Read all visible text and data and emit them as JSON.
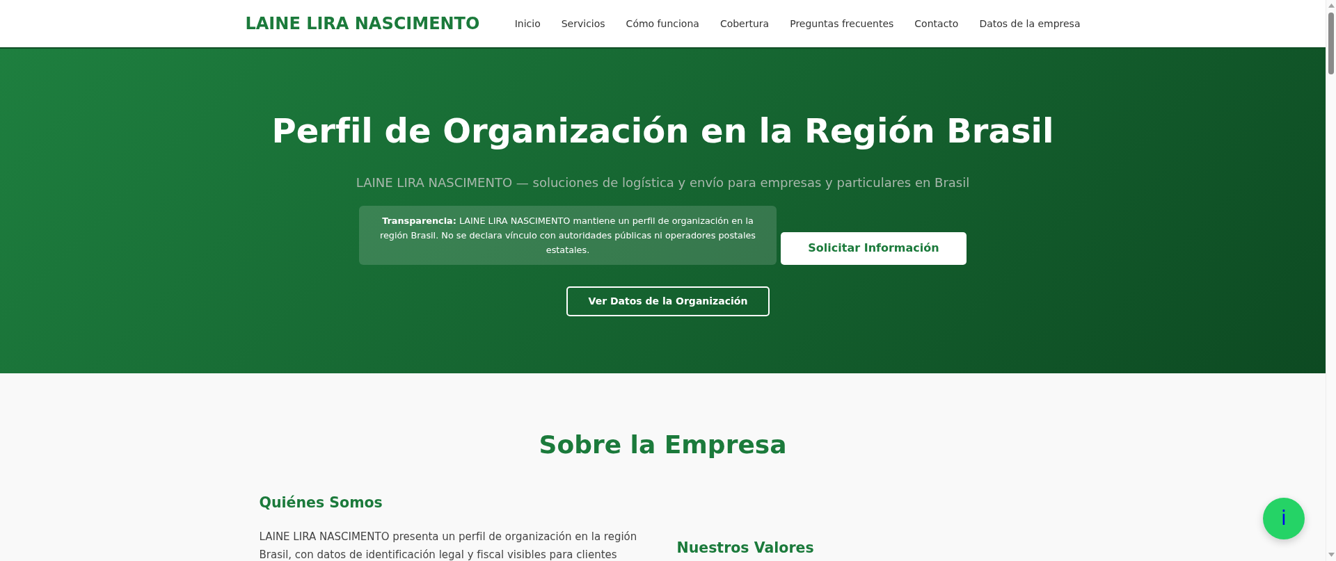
{
  "navbar": {
    "brand": "LAINE LIRA NASCIMENTO",
    "links": [
      {
        "label": "Inicio"
      },
      {
        "label": "Servicios"
      },
      {
        "label": "Cómo funciona"
      },
      {
        "label": "Cobertura"
      },
      {
        "label": "Preguntas frecuentes"
      },
      {
        "label": "Contacto"
      },
      {
        "label": "Datos de la empresa"
      }
    ]
  },
  "hero": {
    "title": "Perfil de Organización en la Región Brasil",
    "subtitle": "LAINE LIRA NASCIMENTO — soluciones de logística y envío para empresas y particulares en Brasil",
    "notice": "**Transparencia:** LAINE LIRA NASCIMENTO mantiene un perfil de organización en la región Brasil. No se declara vínculo con autoridades públicas ni operadores postales estatales.",
    "buttons": [
      {
        "label": "Solicitar Información",
        "kind": "solid"
      },
      {
        "label": "Ver Datos de la Organización",
        "kind": "outline"
      }
    ]
  },
  "about": {
    "title": "Sobre la Empresa",
    "columns": [
      {
        "heading": "Quiénes Somos",
        "text": "LAINE LIRA NASCIMENTO presenta un perfil de organización en la región Brasil, con datos de identificación legal y fiscal visibles para clientes"
      },
      {
        "heading": "Nuestros Valores"
      }
    ]
  },
  "floating_button": {
    "label": "i"
  }
}
